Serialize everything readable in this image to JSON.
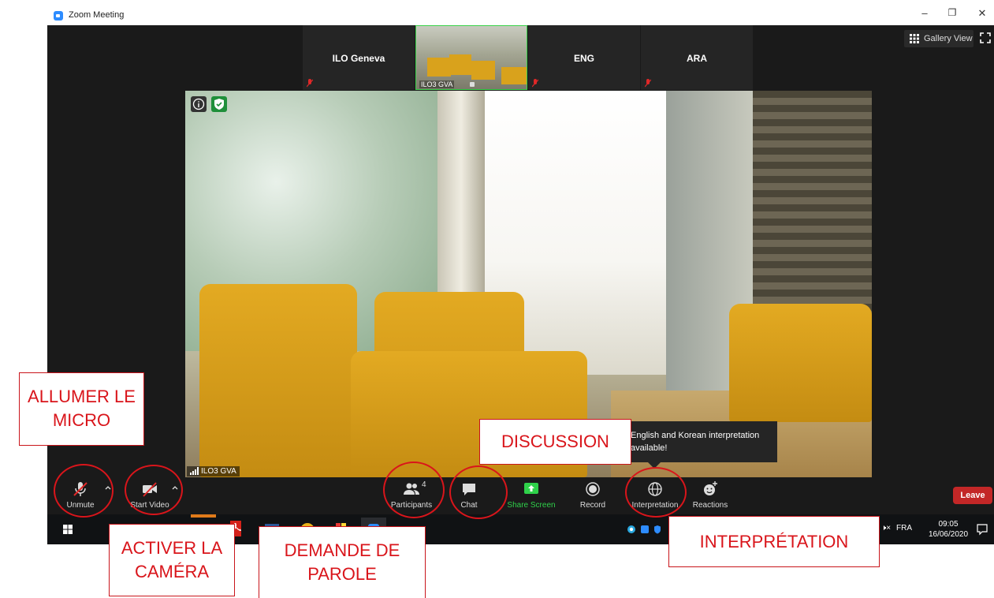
{
  "window": {
    "title": "Zoom Meeting",
    "min": "–",
    "max": "❐",
    "close": "✕"
  },
  "thumbnails": [
    {
      "name": "ILO Geneva"
    },
    {
      "name": "ILO3 GVA"
    },
    {
      "name": "ENG"
    },
    {
      "name": "ARA"
    }
  ],
  "gallery_view_label": "Gallery View",
  "main_video": {
    "label": "ILO3 GVA"
  },
  "tooltip": {
    "text": "English and Korean interpretation available!"
  },
  "toolbar": {
    "unmute": "Unmute",
    "start_video": "Start Video",
    "participants": "Participants",
    "participants_count": "4",
    "chat": "Chat",
    "share_screen": "Share Screen",
    "record": "Record",
    "interpretation": "Interpretation",
    "reactions": "Reactions",
    "leave": "Leave"
  },
  "taskbar": {
    "volume": "🕨×",
    "language": "FRA",
    "time": "09:05",
    "date": "16/06/2020"
  },
  "annotations": {
    "micro": "ALLUMER LE MICRO",
    "camera": "ACTIVER LA CAMÉRA",
    "discussion": "DISCUSSION",
    "parole": "DEMANDE DE PAROLE",
    "interpretation": "INTERPRÉTATION"
  },
  "colors": {
    "accent": "#2D8CFF",
    "leave": "#C32727",
    "share": "#2FD14A",
    "annotation": "#D9151B"
  }
}
